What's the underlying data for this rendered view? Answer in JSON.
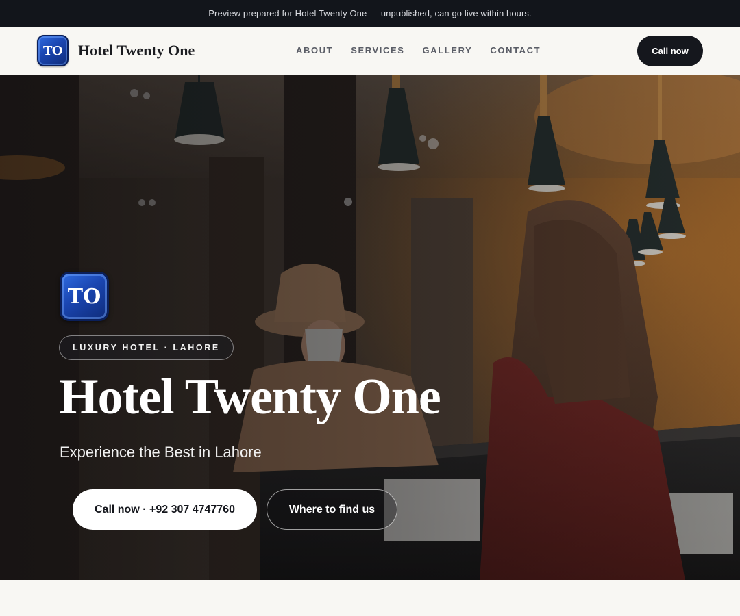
{
  "preview_bar": {
    "text": "Preview prepared for Hotel Twenty One — unpublished, can go live within hours."
  },
  "header": {
    "logo_text": "TO",
    "brand_name": "Hotel Twenty One",
    "nav": [
      {
        "label": "ABOUT"
      },
      {
        "label": "SERVICES"
      },
      {
        "label": "GALLERY"
      },
      {
        "label": "CONTACT"
      }
    ],
    "call_button": "Call now"
  },
  "hero": {
    "logo_text": "TO",
    "badge": "LUXURY HOTEL · LAHORE",
    "title": "Hotel Twenty One",
    "subtitle": "Experience the Best in Lahore",
    "primary_button": "Call now · +92 307 4747760",
    "secondary_button": "Where to find us",
    "background_image": "hotel-reception-photo"
  },
  "colors": {
    "dark": "#15171d",
    "preview_bar_bg": "#12151b",
    "page_bg": "#f8f7f3",
    "logo_blue": "#1a45b0",
    "nav_text": "#5a5d66"
  }
}
